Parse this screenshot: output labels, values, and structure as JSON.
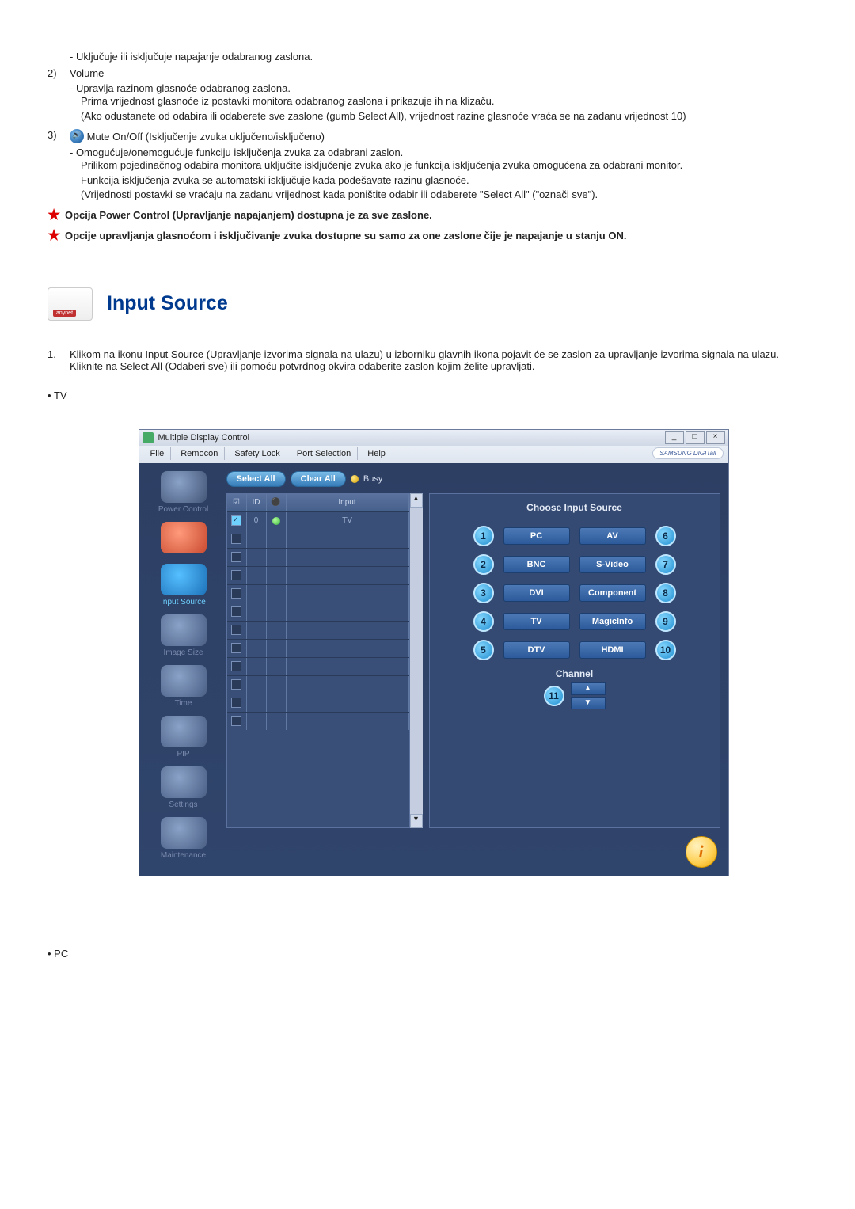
{
  "one": {
    "dash1": "- Uključuje ili isključuje napajanje odabranog zaslona."
  },
  "two": {
    "num": "2)",
    "title": "Volume",
    "dash1": "- Upravlja razinom glasnoće odabranog zaslona.",
    "p1": "Prima vrijednost glasnoće iz postavki monitora odabranog zaslona i prikazuje ih na klizaču.",
    "p2": "(Ako odustanete od odabira ili odaberete sve zaslone (gumb Select All), vrijednost razine glasnoće vraća se na zadanu vrijednost 10)"
  },
  "three": {
    "num": "3)",
    "title": "Mute On/Off (Isključenje zvuka uključeno/isključeno)",
    "dash1": "- Omogućuje/onemogućuje funkciju isključenja zvuka za odabrani zaslon.",
    "p1": "Prilikom pojedinačnog odabira monitora uključite isključenje zvuka ako je funkcija isključenja zvuka omogućena za odabrani monitor.",
    "p2": "Funkcija isključenja zvuka se automatski isključuje kada podešavate razinu glasnoće.",
    "p3": "(Vrijednosti postavki se vraćaju na zadanu vrijednost kada poništite odabir ili odaberete \"Select All\" (\"označi sve\")."
  },
  "stars": {
    "s1": "Opcija Power Control (Upravljanje napajanjem) dostupna je za sve zaslone.",
    "s2": "Opcije upravljanja glasnoćom i isključivanje zvuka dostupne su samo za one zaslone čije je napajanje u stanju ON."
  },
  "section": {
    "title": "Input Source",
    "o1num": "1.",
    "o1": "Klikom na ikonu Input Source (Upravljanje izvorima signala na ulazu) u izborniku glavnih ikona pojavit će se zaslon za upravljanje izvorima signala na ulazu.",
    "o1b": "Kliknite na Select All (Odaberi sve) ili pomoću potvrdnog okvira odaberite zaslon kojim želite upravljati.",
    "bullet1": "TV",
    "bullet2": "PC"
  },
  "app": {
    "title": "Multiple Display Control",
    "menu": {
      "file": "File",
      "remocon": "Remocon",
      "safety": "Safety Lock",
      "port": "Port Selection",
      "help": "Help"
    },
    "brand": "SAMSUNG DIGITall",
    "toolbar": {
      "selectAll": "Select All",
      "clearAll": "Clear All",
      "busy": "Busy"
    },
    "side": {
      "power": "Power Control",
      "inputSource": "Input Source",
      "imageSize": "Image Size",
      "time": "Time",
      "pip": "PIP",
      "settings": "Settings",
      "maintenance": "Maintenance"
    },
    "grid": {
      "h1": "☑",
      "h2": "ID",
      "h3": "⚫",
      "h4": "Input",
      "row0": {
        "id": "0",
        "input": "TV"
      }
    },
    "right": {
      "title": "Choose Input Source",
      "buttons": {
        "pc": "PC",
        "av": "AV",
        "bnc": "BNC",
        "svideo": "S-Video",
        "dvi": "DVI",
        "component": "Component",
        "tv": "TV",
        "magicinfo": "MagicInfo",
        "dtv": "DTV",
        "hdmi": "HDMI"
      },
      "nums": {
        "n1": "1",
        "n2": "2",
        "n3": "3",
        "n4": "4",
        "n5": "5",
        "n6": "6",
        "n7": "7",
        "n8": "8",
        "n9": "9",
        "n10": "10",
        "n11": "11"
      },
      "channel": "Channel",
      "up": "▲",
      "down": "▼"
    }
  }
}
